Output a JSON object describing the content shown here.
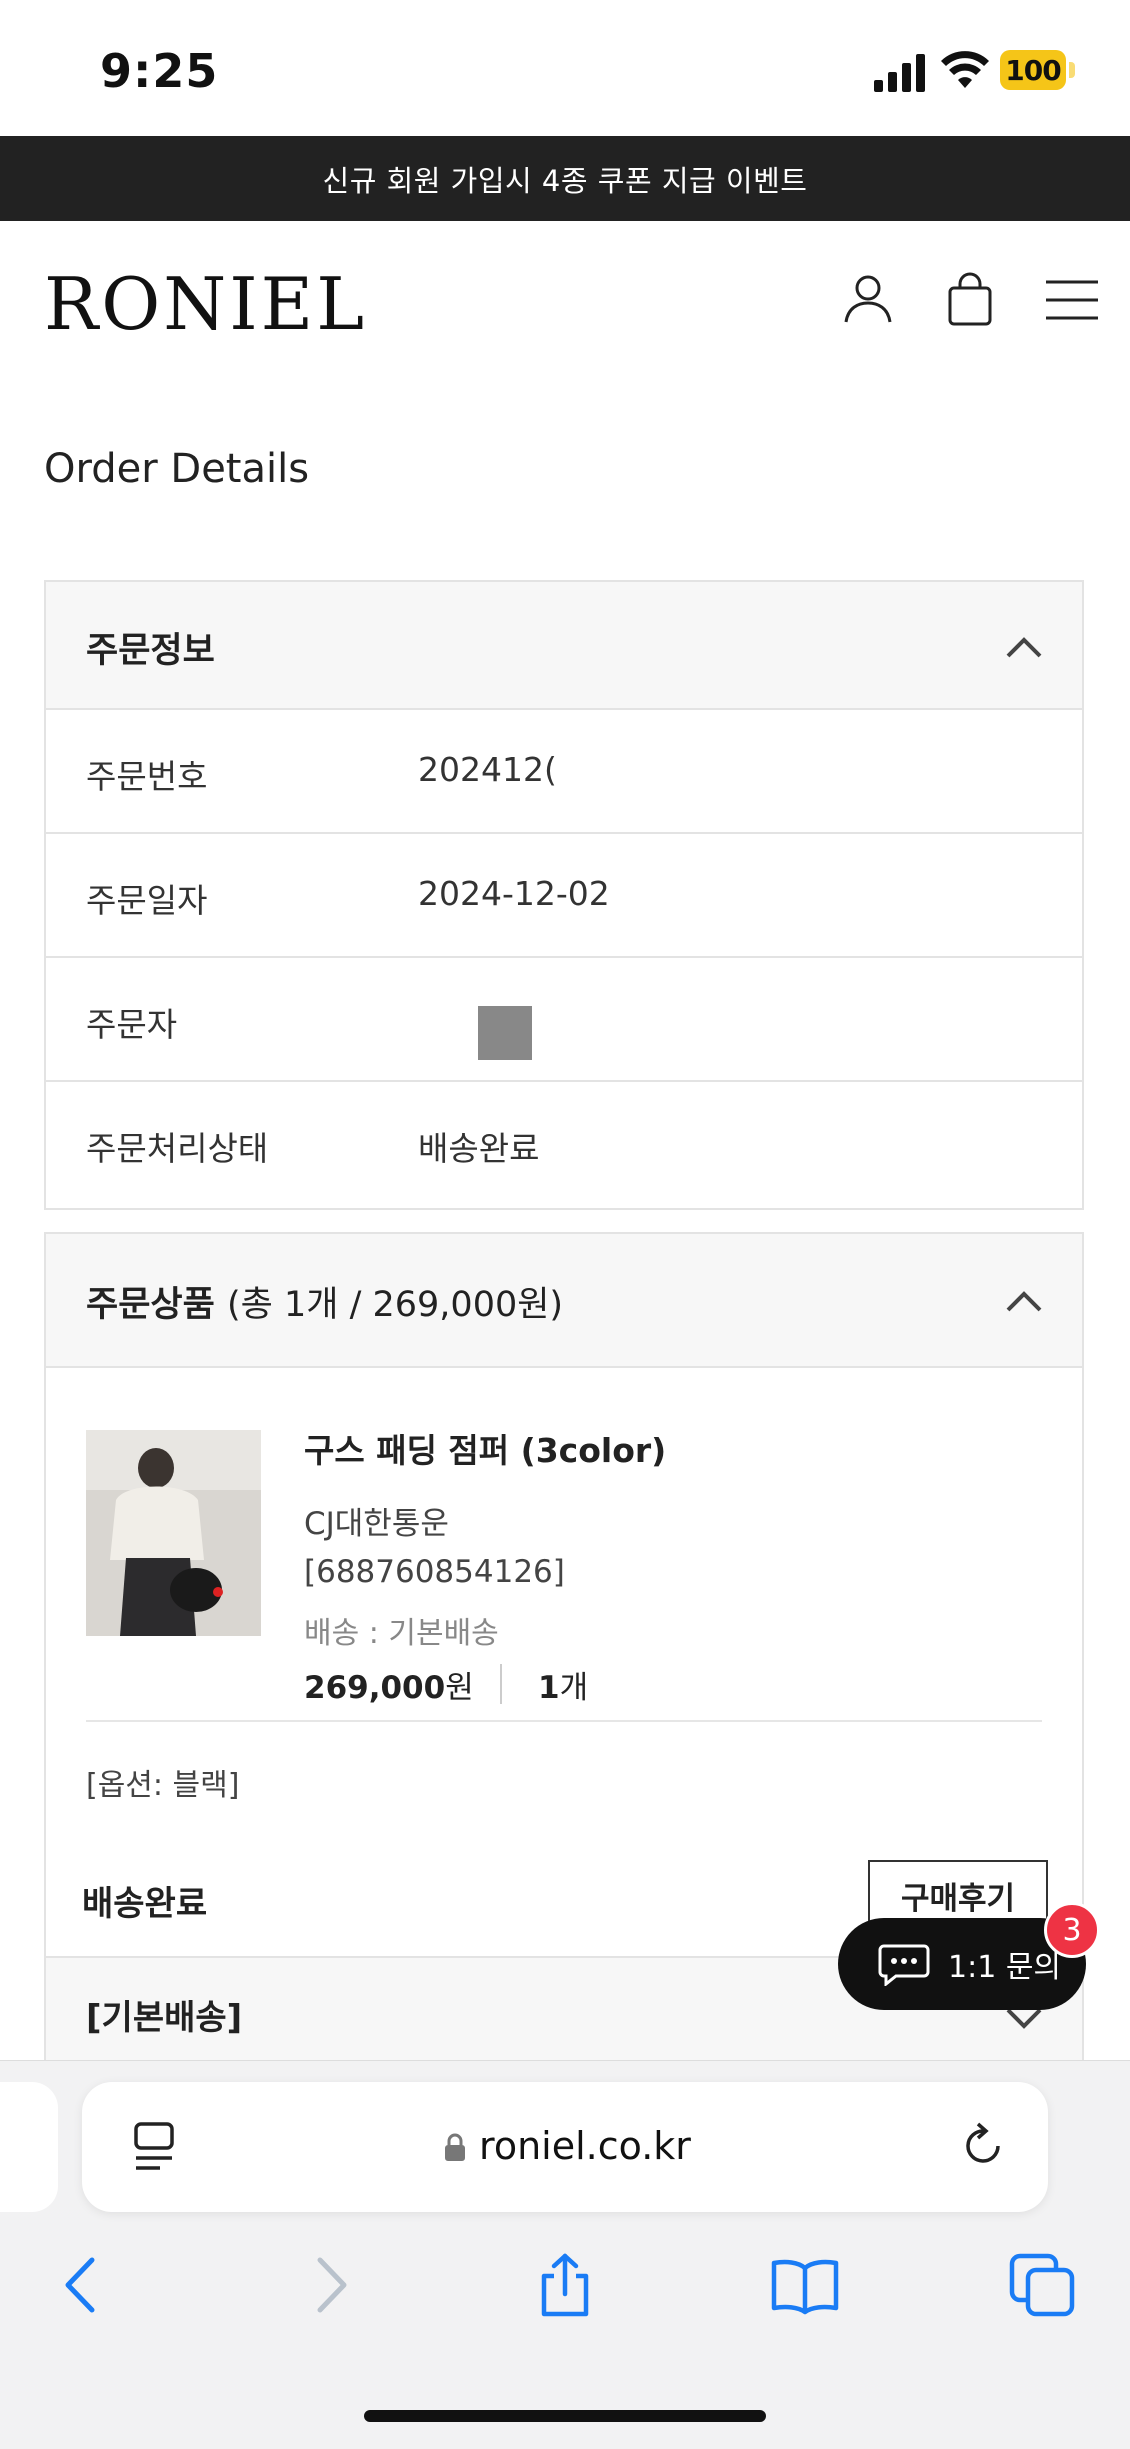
{
  "status_bar": {
    "time": "9:25",
    "battery": "100"
  },
  "banner": "신규 회원 가입시 4종 쿠폰 지급 이벤트",
  "header": {
    "logo": "RONIEL"
  },
  "page_title": "Order Details",
  "order_info": {
    "title": "주문정보",
    "rows": [
      {
        "label": "주문번호",
        "value": "202412("
      },
      {
        "label": "주문일자",
        "value": "2024-12-02"
      },
      {
        "label": "주문자",
        "value": ""
      },
      {
        "label": "주문처리상태",
        "value": "배송완료"
      }
    ]
  },
  "order_items": {
    "title": "주문상품",
    "summary": "(총 1개 / 269,000원)",
    "product": {
      "name": "구스 패딩 점퍼 (3color)",
      "carrier": "CJ대한통운",
      "tracking": "[688760854126]",
      "shipping": "배송 : 기본배송",
      "price": "269,000",
      "price_unit": "원",
      "qty": "1",
      "qty_unit": "개",
      "option": "[옵션: 블랙]",
      "status": "배송완료",
      "review_button": "구매후기"
    }
  },
  "basic_shipping": "[기본배송]",
  "chat": {
    "label": "1:1 문의",
    "badge": "3"
  },
  "browser": {
    "url": "roniel.co.kr"
  }
}
